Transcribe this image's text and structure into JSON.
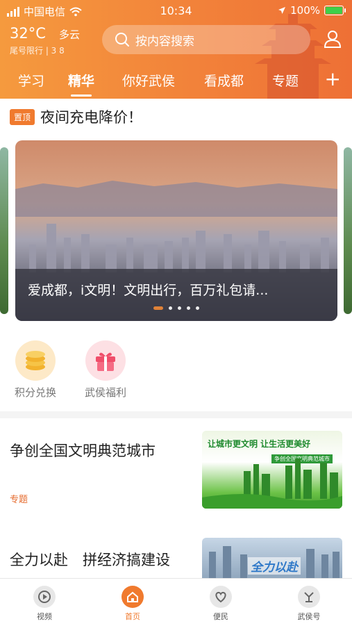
{
  "status_bar": {
    "carrier": "中国电信",
    "time": "10:34",
    "battery": "100%"
  },
  "weather": {
    "temperature": "32°C",
    "condition": "多云",
    "restriction": "尾号限行 | 3 8"
  },
  "search": {
    "placeholder": "按内容搜索"
  },
  "tabs": [
    {
      "label": "学习"
    },
    {
      "label": "精华",
      "active": true
    },
    {
      "label": "你好武侯"
    },
    {
      "label": "看成都"
    },
    {
      "label": "专题"
    }
  ],
  "pinned": {
    "tag": "置顶",
    "title": "夜间充电降价！"
  },
  "banner": {
    "caption": "爱成都，i文明！文明出行，百万礼包请...",
    "page_count": 5,
    "active_index": 0
  },
  "quick_links": [
    {
      "label": "积分兑换",
      "icon": "coins-icon"
    },
    {
      "label": "武侯福利",
      "icon": "gift-icon"
    }
  ],
  "news": [
    {
      "title": "争创全国文明典范城市",
      "tag": "专题",
      "thumb_text_1": "让城市更文明 让生活更美好",
      "thumb_text_2": "争创全国文明典范城市"
    },
    {
      "title": "全力以赴　拼经济搞建设",
      "thumb_text_1": "全力以赴"
    }
  ],
  "bottom_nav": [
    {
      "label": "视频",
      "icon": "play-icon"
    },
    {
      "label": "首页",
      "icon": "home-icon",
      "active": true
    },
    {
      "label": "便民",
      "icon": "heart-icon"
    },
    {
      "label": "武侯号",
      "icon": "wuhou-icon"
    }
  ],
  "colors": {
    "accent": "#f07a2e",
    "header_start": "#f59a3e",
    "header_end": "#ee7035"
  }
}
